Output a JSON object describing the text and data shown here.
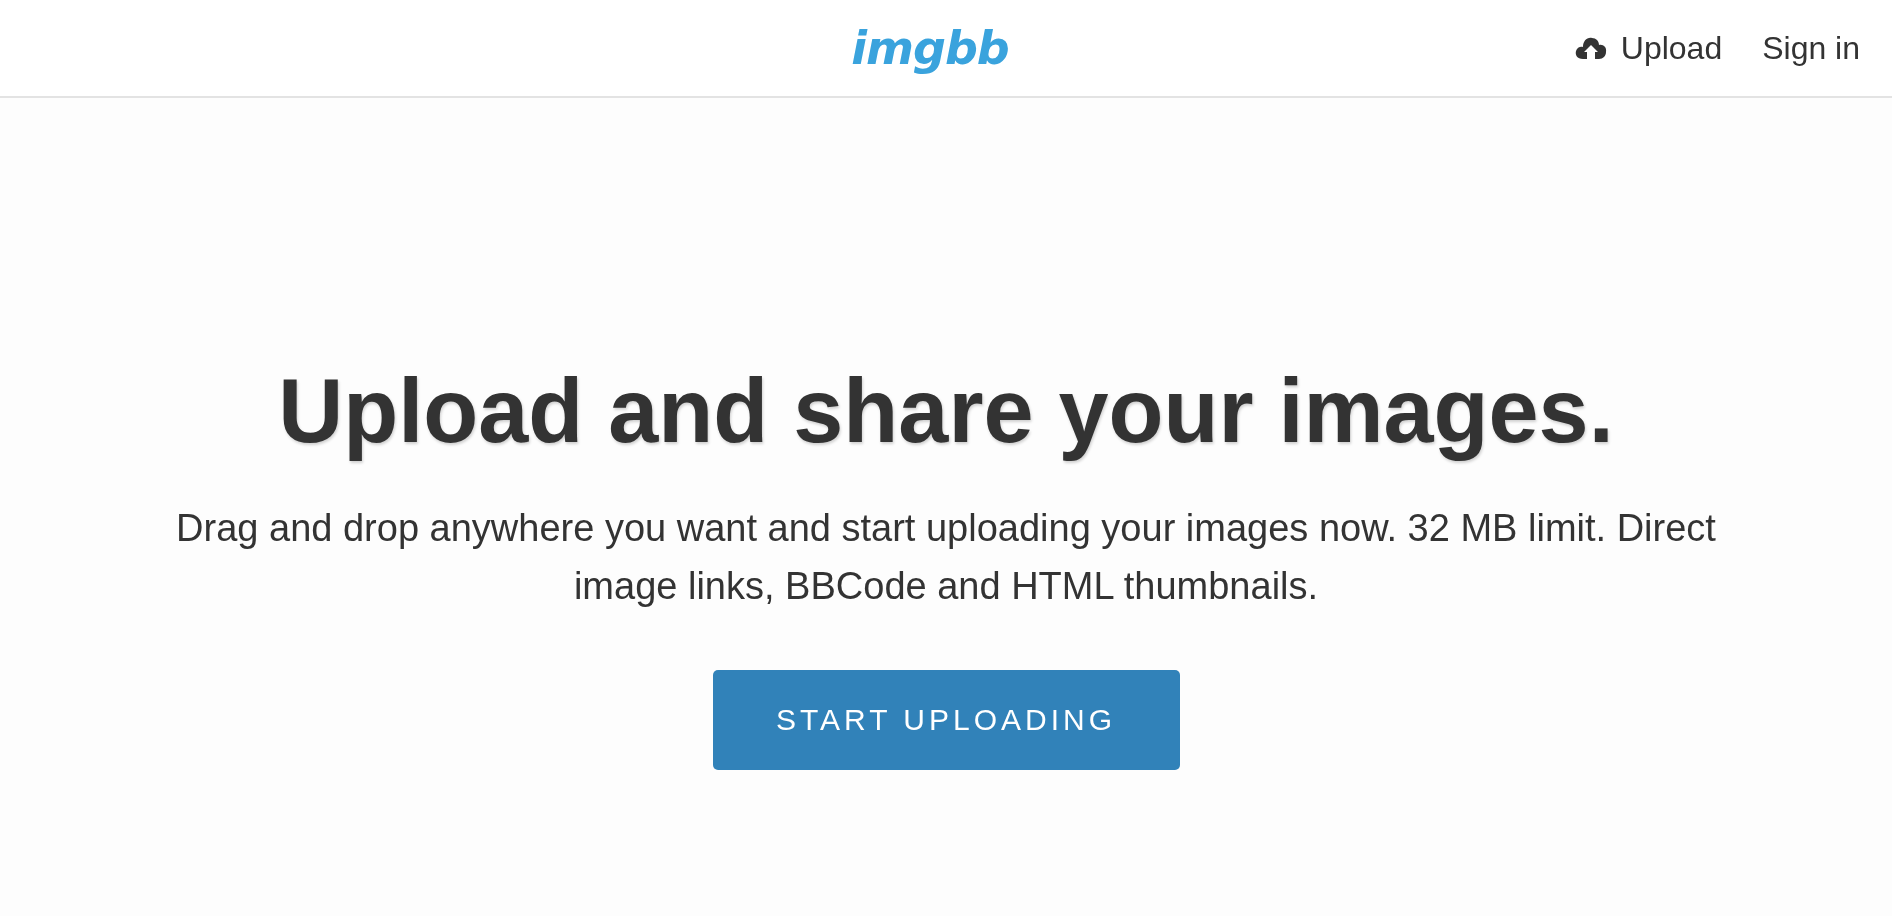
{
  "header": {
    "logo": "imgbb",
    "nav": [
      {
        "kind": "upload",
        "label": "Upload"
      },
      {
        "kind": "link",
        "label": "Sign in"
      }
    ]
  },
  "hero": {
    "title": "Upload and share your images.",
    "description": "Drag and drop anywhere you want and start uploading your images now. 32 MB limit. Direct image links, BBCode and HTML thumbnails.",
    "button": "START UPLOADING"
  }
}
